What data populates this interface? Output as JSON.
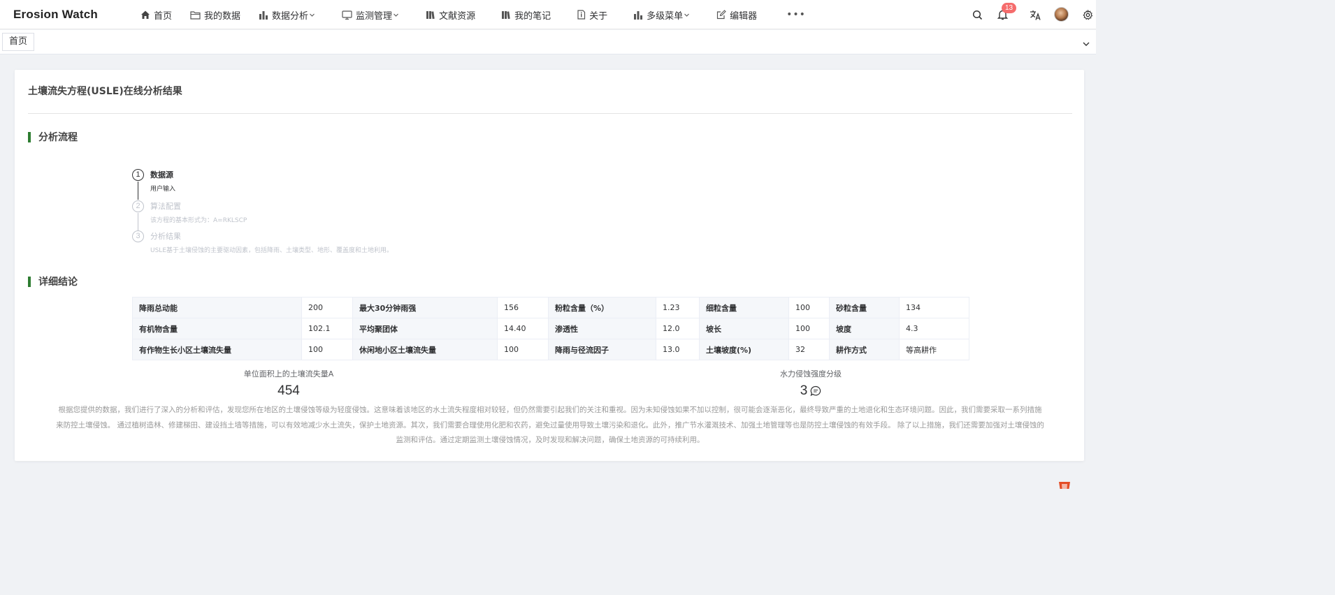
{
  "app": {
    "brand": "Erosion Watch"
  },
  "nav": {
    "items": [
      {
        "label": "首页",
        "icon": "home-icon",
        "dropdown": false
      },
      {
        "label": "我的数据",
        "icon": "folder-icon",
        "dropdown": false
      },
      {
        "label": "数据分析",
        "icon": "bar-chart-icon",
        "dropdown": true
      },
      {
        "label": "监测管理",
        "icon": "monitor-icon",
        "dropdown": true
      },
      {
        "label": "文献资源",
        "icon": "book-icon",
        "dropdown": false
      },
      {
        "label": "我的笔记",
        "icon": "notebook-icon",
        "dropdown": false
      },
      {
        "label": "关于",
        "icon": "info-icon",
        "dropdown": false
      },
      {
        "label": "多级菜单",
        "icon": "bar-chart-icon",
        "dropdown": true
      },
      {
        "label": "编辑器",
        "icon": "edit-icon",
        "dropdown": false
      }
    ],
    "more_label": "•••"
  },
  "header": {
    "notification_count": "13"
  },
  "tags": {
    "active_label": "首页"
  },
  "page": {
    "title": "土壤流失方程(USLE)在线分析结果",
    "process_title": "分析流程",
    "detail_title": "详细结论"
  },
  "steps": [
    {
      "number": "1",
      "title": "数据源",
      "desc": "用户输入",
      "active": true
    },
    {
      "number": "2",
      "title": "算法配置",
      "desc": "该方程的基本形式为：A=RKLSCP",
      "active": false
    },
    {
      "number": "3",
      "title": "分析结果",
      "desc": "USLE基于土壤侵蚀的主要驱动因素，包括降雨、土壤类型、地形、覆盖度和土地利用。",
      "active": false
    }
  ],
  "table": {
    "rows": [
      [
        {
          "label": "降雨总动能",
          "value": "200"
        },
        {
          "label": "最大30分钟雨强",
          "value": "156"
        },
        {
          "label": "粉粒含量（%）",
          "value": "1.23"
        },
        {
          "label": "细粒含量",
          "value": "100"
        },
        {
          "label": "砂粒含量",
          "value": "134"
        }
      ],
      [
        {
          "label": "有机物含量",
          "value": "102.1"
        },
        {
          "label": "平均聚团体",
          "value": "14.40"
        },
        {
          "label": "渗透性",
          "value": "12.0"
        },
        {
          "label": "坡长",
          "value": "100"
        },
        {
          "label": "坡度",
          "value": "4.3"
        }
      ],
      [
        {
          "label": "有作物生长小区土壤流失量",
          "value": "100"
        },
        {
          "label": "休闲地小区土壤流失量",
          "value": "100"
        },
        {
          "label": "降雨与径流因子",
          "value": "13.0"
        },
        {
          "label": "土壤坡度(%)",
          "value": "32"
        },
        {
          "label": "耕作方式",
          "value": "等高耕作"
        }
      ]
    ]
  },
  "stats": {
    "loss": {
      "label": "单位面积上的土壤流失量A",
      "value": "454"
    },
    "grade": {
      "label": "水力侵蚀强度分级",
      "value": "3",
      "icon": "comment-icon"
    }
  },
  "conclusion": {
    "lines": [
      "根据您提供的数据，我们进行了深入的分析和评估，发现您所在地区的土壤侵蚀等级为轻度侵蚀。这意味着该地区的水土流失程度相对较轻，但仍然需要引起我们的关注和重视。因为未知侵蚀如果不加以控制，很可能会逐渐恶化，最终导致严重的土地退化和生态环境问题。因此，我们需要采取一系列措施",
      "来防控土壤侵蚀。 通过植树造林、修建梯田、建设挡土墙等措施，可以有效地减少水土流失，保护土地资源。其次，我们需要合理使用化肥和农药，避免过量使用导致土壤污染和退化。此外，推广节水灌溉技术、加强土地管理等也是防控土壤侵蚀的有效手段。 除了以上措施，我们还需要加强对土壤侵蚀的",
      "监测和评估。通过定期监测土壤侵蚀情况，及时发现和解决问题，确保土地资源的可持续利用。"
    ]
  },
  "colors": {
    "accent": "#2e7d32",
    "badge": "#f56c6c"
  }
}
